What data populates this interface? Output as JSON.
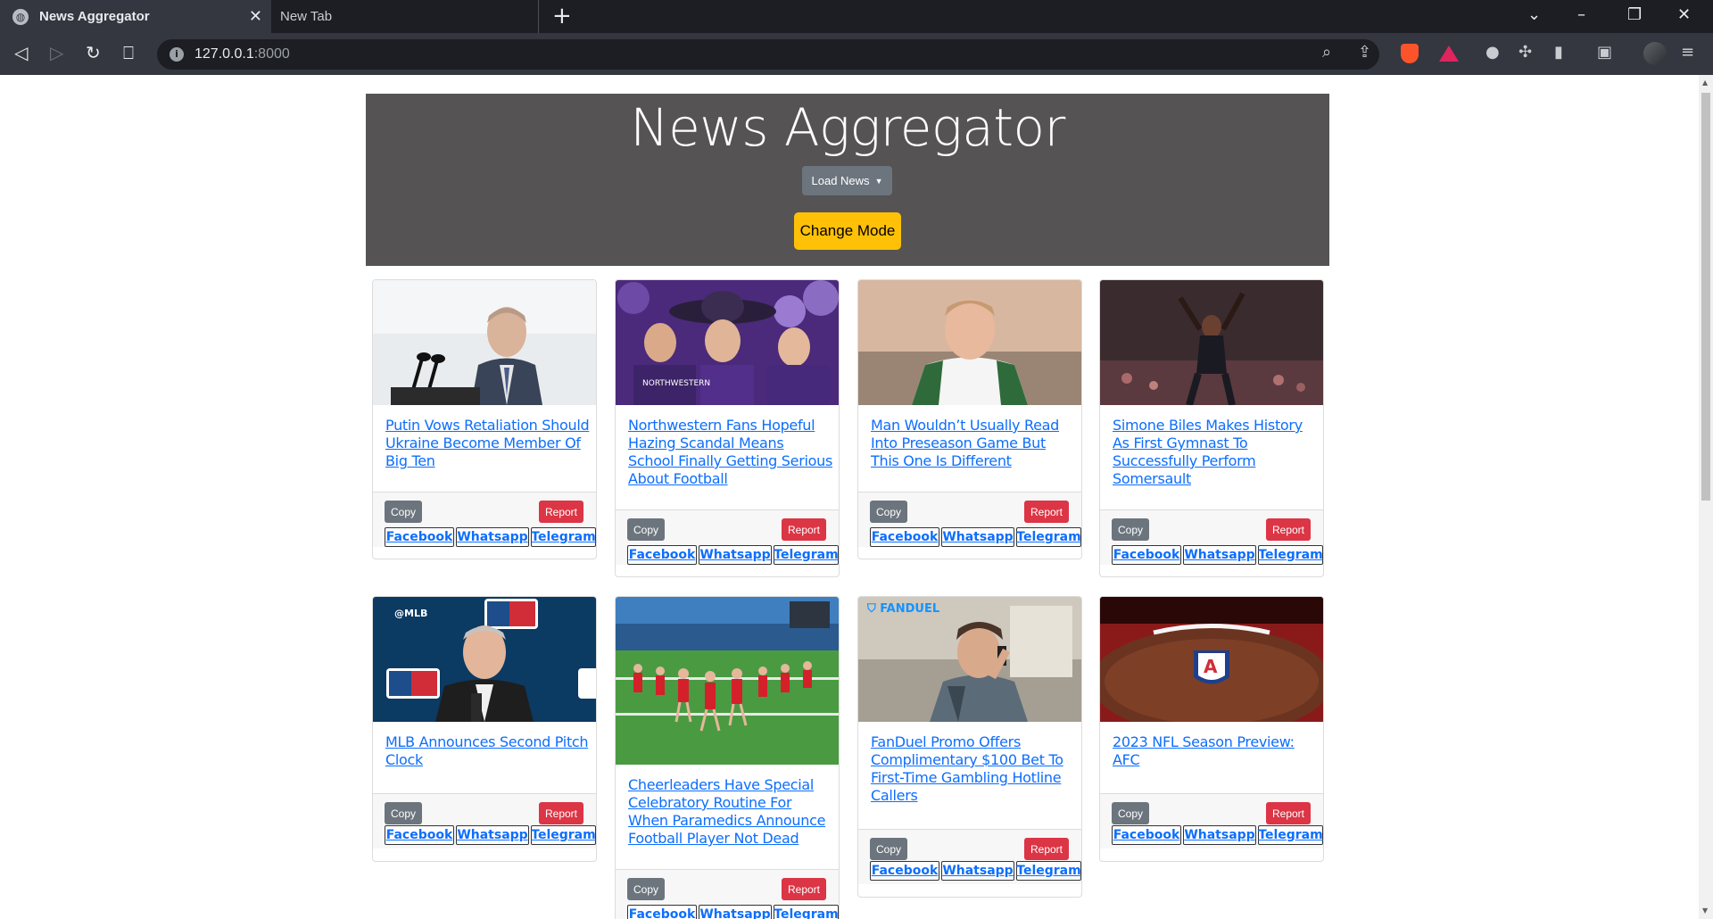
{
  "browser": {
    "tabs": [
      {
        "title": "News Aggregator",
        "active": true
      },
      {
        "title": "New Tab",
        "active": false
      }
    ],
    "url_host": "127.0.0.1",
    "url_port": ":8000"
  },
  "header": {
    "title": "News Aggregator",
    "load_news_label": "Load News",
    "change_mode_label": "Change Mode"
  },
  "card_labels": {
    "copy": "Copy",
    "report": "Report",
    "facebook": "Facebook",
    "whatsapp": "Whatsapp",
    "telegram": "Telegram"
  },
  "articles": [
    {
      "title": "Putin Vows Retaliation Should Ukraine Become Member Of Big Ten",
      "image": "putin-podium-photo"
    },
    {
      "title": "Northwestern Fans Hopeful Hazing Scandal Means School Finally Getting Serious About Football",
      "image": "northwestern-fans-photo"
    },
    {
      "title": "Man Wouldn’t Usually Read Into Preseason Game But This One Is Different",
      "image": "man-on-couch-photo"
    },
    {
      "title": "Simone Biles Makes History As First Gymnast To Successfully Perform Somersault",
      "image": "gymnast-photo"
    },
    {
      "title": "MLB Announces Second Pitch Clock",
      "image": "mlb-commissioner-photo",
      "image_text": "@MLB"
    },
    {
      "title": "Cheerleaders Have Special Celebratory Routine For When Paramedics Announce Football Player Not Dead",
      "image": "cheerleaders-photo"
    },
    {
      "title": "FanDuel Promo Offers Complimentary $100 Bet To First-Time Gambling Hotline Callers",
      "image": "fanduel-caller-photo",
      "image_text": "FANDUEL"
    },
    {
      "title": "2023 NFL Season Preview: AFC",
      "image": "nfl-football-photo"
    }
  ],
  "colors": {
    "header_bg": "#555353",
    "change_mode": "#ffc107",
    "load_news": "#6c757d",
    "copy": "#6c757d",
    "report": "#dc3545",
    "link": "#0d6efd"
  }
}
